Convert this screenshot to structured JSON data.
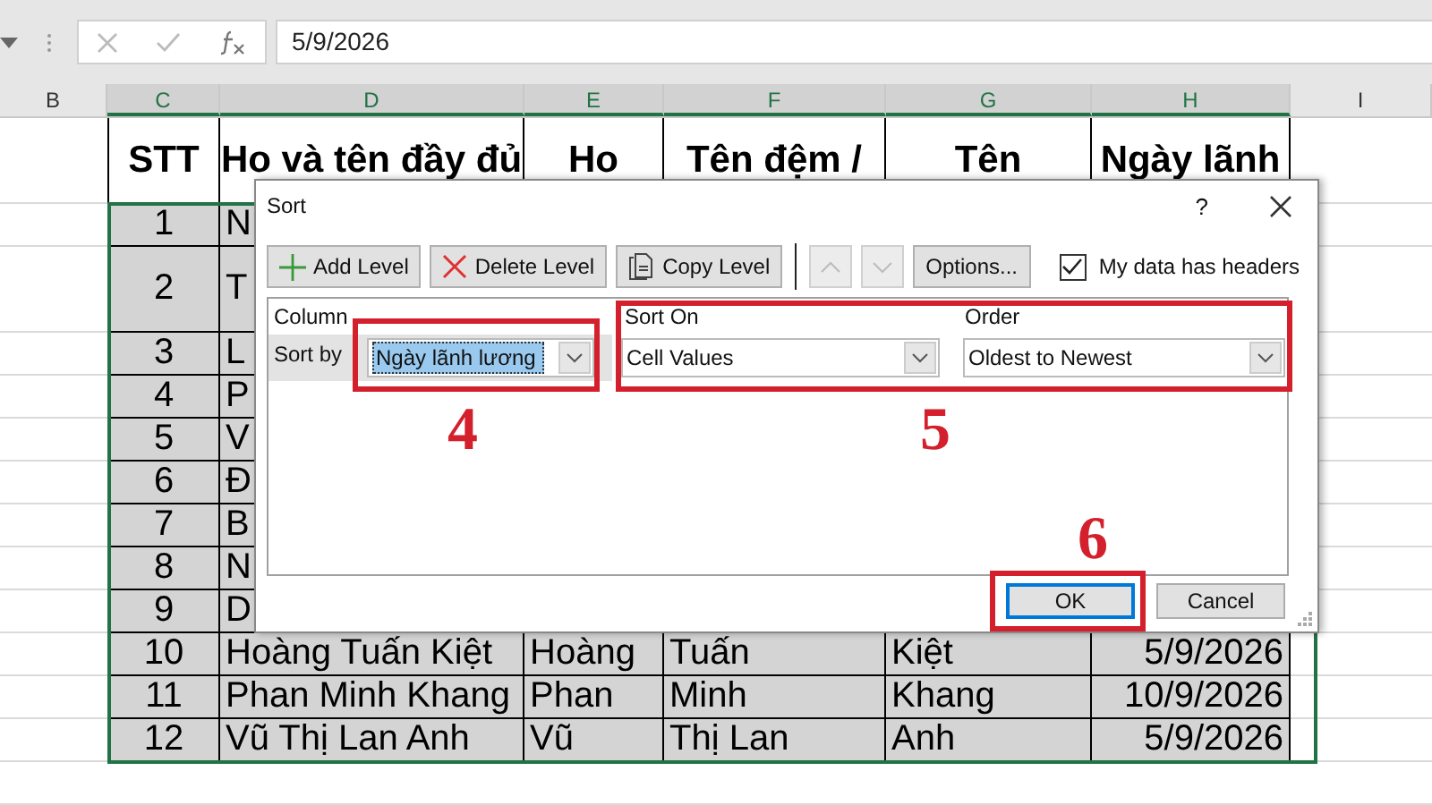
{
  "formula_bar": {
    "value": "5/9/2026"
  },
  "columns": [
    {
      "label": "B",
      "selected": false
    },
    {
      "label": "C",
      "selected": true
    },
    {
      "label": "D",
      "selected": true
    },
    {
      "label": "E",
      "selected": true
    },
    {
      "label": "F",
      "selected": true
    },
    {
      "label": "G",
      "selected": true
    },
    {
      "label": "H",
      "selected": true
    },
    {
      "label": "I",
      "selected": false
    }
  ],
  "header_row": [
    "STT",
    "Ho và tên đầy đủ",
    "Ho",
    "Tên đệm /",
    "Tên",
    "Ngày lãnh"
  ],
  "rows": [
    {
      "cells": [
        "1",
        "N"
      ]
    },
    {
      "cells": [
        "2",
        "T"
      ]
    },
    {
      "cells": [
        "3",
        "L"
      ]
    },
    {
      "cells": [
        "4",
        "P"
      ]
    },
    {
      "cells": [
        "5",
        "V"
      ]
    },
    {
      "cells": [
        "6",
        "Đ"
      ]
    },
    {
      "cells": [
        "7",
        "B"
      ]
    },
    {
      "cells": [
        "8",
        "N"
      ]
    },
    {
      "cells": [
        "9",
        "D"
      ]
    },
    {
      "cells": [
        "10",
        "Hoàng Tuấn Kiệt",
        "Hoàng",
        "Tuấn",
        "Kiệt",
        "5/9/2026"
      ]
    },
    {
      "cells": [
        "11",
        "Phan Minh Khang",
        "Phan",
        "Minh",
        "Khang",
        "10/9/2026"
      ]
    },
    {
      "cells": [
        "12",
        "Vũ Thị Lan Anh",
        "Vũ",
        "Thị Lan",
        "Anh",
        "5/9/2026"
      ]
    }
  ],
  "dialog": {
    "title": "Sort",
    "help": "?",
    "toolbar": [
      {
        "kind": "add",
        "label": "Add Level",
        "disabled": false
      },
      {
        "kind": "delete",
        "label": "Delete Level",
        "disabled": false
      },
      {
        "kind": "copy",
        "label": "Copy Level",
        "disabled": false
      },
      {
        "kind": "up",
        "disabled": true
      },
      {
        "kind": "down",
        "disabled": true
      },
      {
        "kind": "options",
        "label": "Options...",
        "disabled": false
      }
    ],
    "headers_checkbox": {
      "label": "My data has headers",
      "checked": true
    },
    "grid_headers": [
      "Column",
      "Sort On",
      "Order"
    ],
    "level": {
      "label": "Sort by",
      "column": "Ngày lãnh lương",
      "sort_on": "Cell Values",
      "order": "Oldest to Newest",
      "selected": true
    },
    "buttons": [
      {
        "label": "OK",
        "default": true
      },
      {
        "label": "Cancel",
        "default": false
      }
    ]
  },
  "annotations": [
    {
      "label": "4"
    },
    {
      "label": "5"
    },
    {
      "label": "6"
    }
  ]
}
